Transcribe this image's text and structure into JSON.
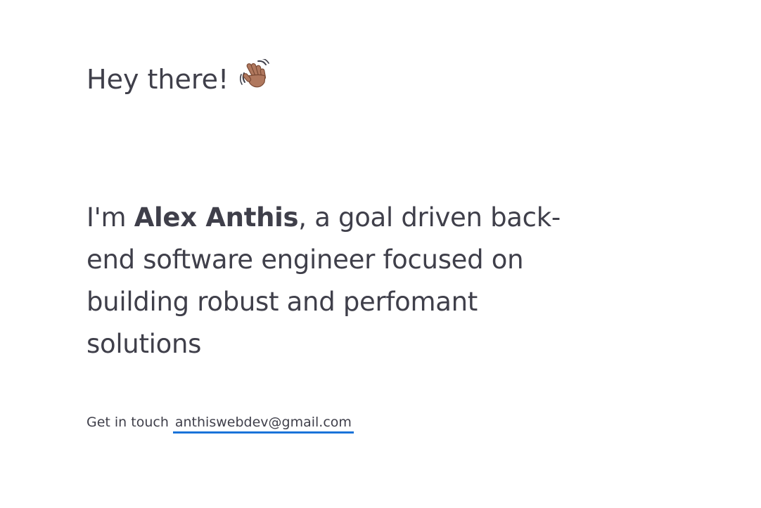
{
  "greeting": {
    "text": "Hey there!",
    "icon": "waving-hand-icon"
  },
  "intro": {
    "prefix": "I'm ",
    "name": "Alex Anthis",
    "rest": ", a goal driven back-end software engineer focused on building robust and perfomant solutions"
  },
  "contact": {
    "label": "Get in touch",
    "email": "anthiswebdev@gmail.com"
  },
  "colors": {
    "text": "#3f3f4a",
    "link_underline": "#1a73d9",
    "background": "#ffffff"
  }
}
